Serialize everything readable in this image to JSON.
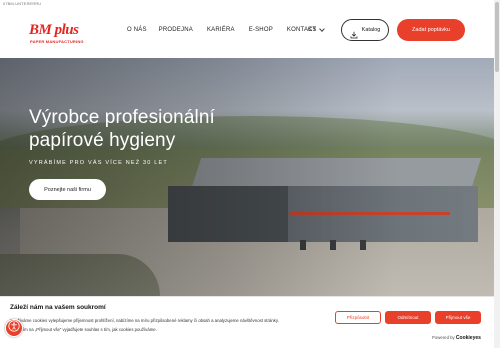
{
  "topline": {
    "text": "07BM-UNTERERRU"
  },
  "brand": {
    "logo_main": "BM plus",
    "logo_sub": "PAPER MANUFACTURING",
    "color": "#e3261f"
  },
  "nav": {
    "items": [
      {
        "label": "O NÁS"
      },
      {
        "label": "PRODEJNA"
      },
      {
        "label": "KARIÉRA"
      },
      {
        "label": "E-SHOP"
      },
      {
        "label": "KONTAKT"
      }
    ],
    "language": "CS"
  },
  "header_buttons": {
    "catalog_label": "Katalog",
    "catalog_icon": "download-icon",
    "quote_label": "Zadat poptávku",
    "accent": "#e8402a"
  },
  "hero": {
    "title_line1": "Výrobce profesionální",
    "title_line2": "papírové hygieny",
    "subtitle": "VYRÁBÍME PRO VÁS VÍCE NEŽ 30 LET",
    "button_label": "Poznejte naši firmu"
  },
  "cookie": {
    "title": "Záleží nám na vašem soukromí",
    "text_line1": "Používáme cookies vylepšujeme příjemnost prohlížení, nabízíme na míru přizpůsobené reklamy či obsah a analyzujeme návštěvnost stránky.",
    "text_line2": "Kliknutím na „Přijmout vše“ vyjadřujete souhlas s tím, jak cookies používáme.",
    "customize_label": "Přizpůsobit",
    "reject_label": "Odmítnout",
    "accept_label": "Přijmout vše",
    "powered_prefix": "Powered by",
    "powered_brand": "Cookieyes"
  },
  "accessibility": {
    "icon": "accessibility-icon"
  }
}
